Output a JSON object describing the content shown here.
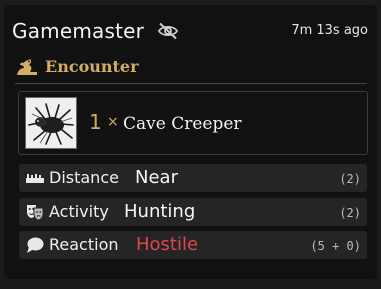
{
  "header": {
    "title": "Gamemaster",
    "time": "7m 13s ago",
    "visibility_icon": "eye-slash-icon"
  },
  "section": {
    "title": "Encounter",
    "icon": "dragon-icon"
  },
  "encounter": {
    "quantity": "1",
    "times": "×",
    "creature": "Cave Creeper",
    "thumbnail_icon": "creature-portrait"
  },
  "rows": [
    {
      "icon": "ruler-icon",
      "label": "Distance",
      "value": "Near",
      "roll": "(2)"
    },
    {
      "icon": "theater-masks-icon",
      "label": "Activity",
      "value": "Hunting",
      "roll": "(2)"
    },
    {
      "icon": "speech-bubble-icon",
      "label": "Reaction",
      "value": "Hostile",
      "roll": "(5 + 0)"
    }
  ],
  "colors": {
    "accent_gold": "#d2ae63",
    "hostile_red": "#e0474c",
    "row_bg": "#252525",
    "card_bg": "#111111"
  }
}
